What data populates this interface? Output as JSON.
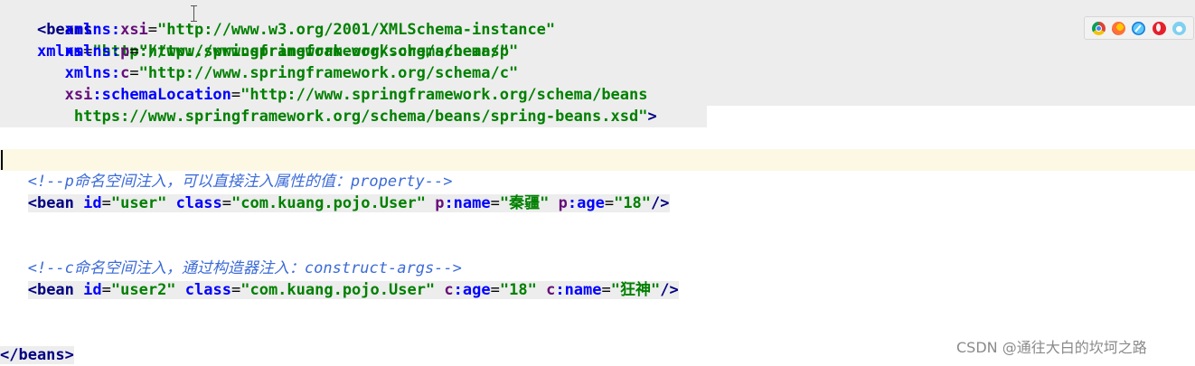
{
  "code": {
    "line1": {
      "open": "<beans",
      "attr": "xmlns",
      "eq": "=",
      "value": "\"http://www.springframework.org/schema/beans\""
    },
    "line2": {
      "prefix": "xmlns:",
      "ns": "xsi",
      "eq": "=",
      "value": "\"http://www.w3.org/2001/XMLSchema-instance\""
    },
    "line3": {
      "prefix": "xmlns:",
      "ns": "p",
      "eq": "=",
      "value": "\"http://www.springframework.org/schema/p\""
    },
    "line4": {
      "prefix": "xmlns:",
      "ns": "c",
      "eq": "=",
      "value": "\"http://www.springframework.org/schema/c\""
    },
    "line5": {
      "ns": "xsi",
      "attr": ":schemaLocation",
      "eq": "=",
      "value": "\"http://www.springframework.org/schema/beans"
    },
    "line6": {
      "value": "https://www.springframework.org/schema/beans/spring-beans.xsd\"",
      "close": ">"
    },
    "comment1": {
      "text": "<!--p命名空间注入，可以直接注入属性的值：property-->"
    },
    "bean1": {
      "open": "<bean",
      "id_attr": "id",
      "id_val": "\"user\"",
      "class_attr": "class",
      "class_val": "\"com.kuang.pojo.User\"",
      "p_ns": "p",
      "p_attr": ":name",
      "p_val_q1": "\"",
      "p_val": "秦疆",
      "p_val_q2": "\"",
      "p2_ns": "p",
      "p2_attr": ":age",
      "p2_val": "\"18\"",
      "close": "/>"
    },
    "comment2": {
      "text": "<!--c命名空间注入，通过构造器注入：construct-args-->"
    },
    "bean2": {
      "open": "<bean",
      "id_attr": "id",
      "id_val": "\"user2\"",
      "class_attr": "class",
      "class_val": "\"com.kuang.pojo.User\"",
      "c_ns": "c",
      "c_attr": ":age",
      "c_val": "\"18\"",
      "c2_ns": "c",
      "c2_attr": ":name",
      "c2_val_q1": "\"",
      "c2_val": "狂神",
      "c2_val_q2": "\"",
      "close": "/>"
    },
    "end": {
      "text": "</beans>"
    }
  },
  "browser_icons": [
    "chrome-icon",
    "firefox-icon",
    "safari-icon",
    "opera-icon",
    "edge-icon"
  ],
  "watermark": "CSDN @通往大白的坎坷之路",
  "colors": {
    "tag": "#000080",
    "attribute": "#0000ff",
    "namespace": "#660e7a",
    "value": "#008000",
    "comment": "#3c6bd6",
    "selection": "#ededed",
    "caret_line": "#fdf8e4"
  }
}
